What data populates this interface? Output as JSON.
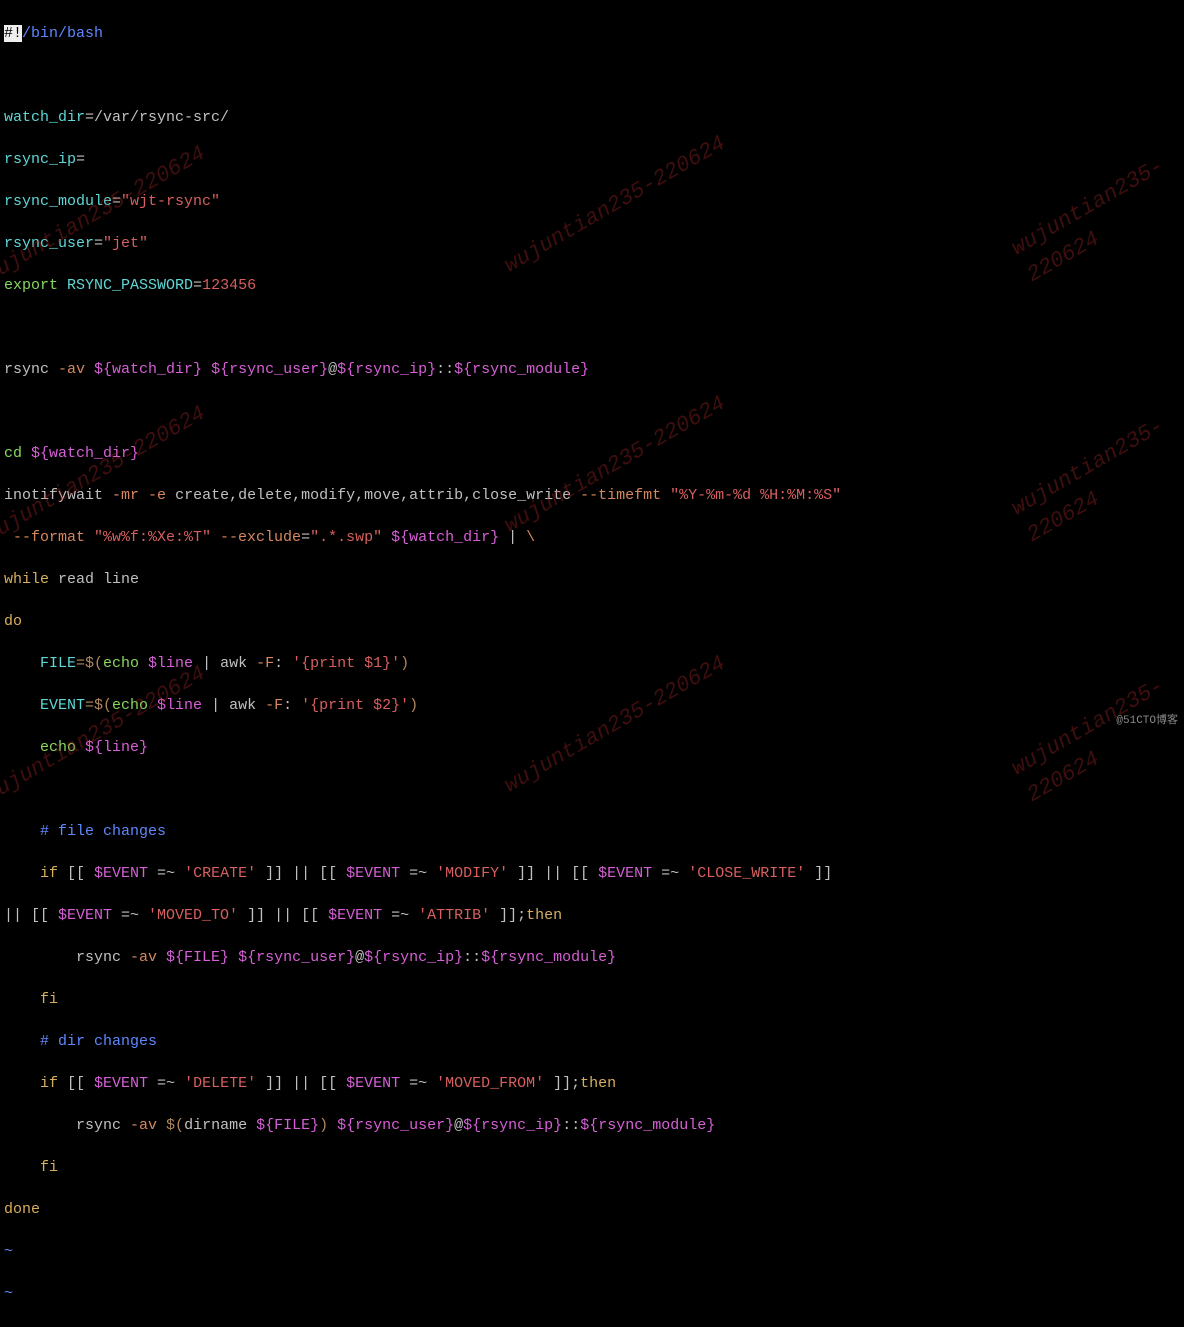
{
  "lines": {
    "l1a": "#!",
    "l1b": "/bin/bash",
    "l3a": "watch_dir",
    "l3b": "=/var/rsync-src/",
    "l4a": "rsync_ip",
    "l4b": "=",
    "l5a": "rsync_module",
    "l5b": "=",
    "l5c": "\"wjt-rsync\"",
    "l6a": "rsync_user",
    "l6b": "=",
    "l6c": "\"jet\"",
    "l7a": "export",
    "l7b": " RSYNC_PASSWORD",
    "l7c": "=",
    "l7d": "123456",
    "l9a": "rsync ",
    "l9b": "-av",
    "l9c": " ${watch_dir}",
    "l9d": " ${rsync_user}",
    "l9e": "@",
    "l9f": "${rsync_ip}",
    "l9g": "::",
    "l9h": "${rsync_module}",
    "l11a": "cd",
    "l11b": " ${watch_dir}",
    "l12a": "inotifywait ",
    "l12b": "-mr",
    "l12c": " -e",
    "l12d": " create,delete,modify,move,attrib,close_write ",
    "l12e": "--timefmt",
    "l12f": " \"%Y-%m-%d %H:%M:%S\"",
    "l13a": " --format",
    "l13b": " \"%w%f:%Xe:%T\"",
    "l13c": " --exclude",
    "l13d": "=",
    "l13e": "\".*.swp\"",
    "l13f": " ${watch_dir}",
    "l13g": " | ",
    "l13h": "\\",
    "l14": "while",
    "l14b": " read line",
    "l15": "do",
    "l16a": "    FILE",
    "l16b": "=$(",
    "l16c": "echo",
    "l16d": " $line",
    "l16e": " | ",
    "l16f": "awk ",
    "l16g": "-F",
    "l16h": ": ",
    "l16i": "'{print $1}'",
    "l16j": ")",
    "l17a": "    EVENT",
    "l17b": "=$(",
    "l17c": "echo",
    "l17d": " $line",
    "l17e": " | ",
    "l17f": "awk ",
    "l17g": "-F",
    "l17h": ": ",
    "l17i": "'{print $2}'",
    "l17j": ")",
    "l18a": "    echo",
    "l18b": " ${line}",
    "l20": "    # file changes",
    "l21a": "    if",
    "l21b": " [[ ",
    "l21c": "$EVENT",
    "l21d": " =~ ",
    "l21e": "'CREATE'",
    "l21f": " ]] || [[ ",
    "l21g": "$EVENT",
    "l21h": " =~ ",
    "l21i": "'MODIFY'",
    "l21j": " ]] || [[ ",
    "l21k": "$EVENT",
    "l21l": " =~ ",
    "l21m": "'CLOSE_WRITE'",
    "l21n": " ]]",
    "l22a": "|| [[ ",
    "l22b": "$EVENT",
    "l22c": " =~ ",
    "l22d": "'MOVED_TO'",
    "l22e": " ]] || [[ ",
    "l22f": "$EVENT",
    "l22g": " =~ ",
    "l22h": "'ATTRIB'",
    "l22i": " ]];",
    "l22j": "then",
    "l23a": "        rsync ",
    "l23b": "-av",
    "l23c": " ${FILE}",
    "l23d": " ${rsync_user}",
    "l23e": "@",
    "l23f": "${rsync_ip}",
    "l23g": "::",
    "l23h": "${rsync_module}",
    "l24": "    fi",
    "l25": "    # dir changes",
    "l26a": "    if",
    "l26b": " [[ ",
    "l26c": "$EVENT",
    "l26d": " =~ ",
    "l26e": "'DELETE'",
    "l26f": " ]] || [[ ",
    "l26g": "$EVENT",
    "l26h": " =~ ",
    "l26i": "'MOVED_FROM'",
    "l26j": " ]];",
    "l26k": "then",
    "l27a": "        rsync ",
    "l27b": "-av",
    "l27c": " $(",
    "l27d": "dirname ",
    "l27e": "${FILE}",
    "l27f": ")",
    "l27g": " ${rsync_user}",
    "l27h": "@",
    "l27i": "${rsync_ip}",
    "l27j": "::",
    "l27k": "${rsync_module}",
    "l28": "    fi",
    "l29": "done",
    "tilde": "~"
  },
  "watermark": "wujuntian235-220624",
  "attribution": "@51CTO博客"
}
